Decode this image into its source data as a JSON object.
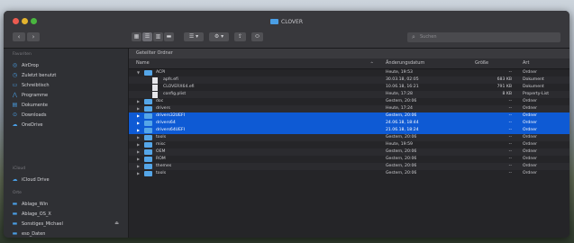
{
  "window": {
    "title": "CLOVER"
  },
  "search": {
    "placeholder": "Suchen"
  },
  "toolbar": {
    "back": "‹",
    "forward": "›",
    "view_icon": "▦",
    "view_list": "☰",
    "view_columns": "▥",
    "view_gallery": "▬",
    "group": "☰ ▾",
    "action": "⚙ ▾",
    "share": "⇪",
    "tag": "⬭"
  },
  "sidebar": {
    "favorites_header": "Favoriten",
    "favorites": [
      {
        "label": "AirDrop",
        "icon": "airdrop-icon",
        "glyph": "◎"
      },
      {
        "label": "Zuletzt benutzt",
        "icon": "clock-icon",
        "glyph": "◷"
      },
      {
        "label": "Schreibtisch",
        "icon": "desktop-icon",
        "glyph": "▭"
      },
      {
        "label": "Programme",
        "icon": "apps-icon",
        "glyph": "⋀"
      },
      {
        "label": "Dokumente",
        "icon": "document-icon",
        "glyph": "▤"
      },
      {
        "label": "Downloads",
        "icon": "download-icon",
        "glyph": "⊙"
      },
      {
        "label": "OneDrive",
        "icon": "cloud-icon",
        "glyph": "☁"
      }
    ],
    "icloud_header": "iCloud",
    "icloud": [
      {
        "label": "iCloud Drive",
        "icon": "cloud-icon",
        "glyph": "☁"
      }
    ],
    "places_header": "Orte",
    "places": [
      {
        "label": "Ablage_Win",
        "icon": "drive-icon",
        "glyph": "▬"
      },
      {
        "label": "Ablage_OS_X",
        "icon": "drive-icon",
        "glyph": "▬"
      },
      {
        "label": "Sonstiges_Michael",
        "icon": "drive-icon",
        "glyph": "▬",
        "eject": "⏏"
      },
      {
        "label": "eso_Daten",
        "icon": "drive-icon",
        "glyph": "▬"
      }
    ]
  },
  "path_bar": "Geteilter Ordner",
  "columns": {
    "name": "Name",
    "date": "Änderungsdatum",
    "size": "Größe",
    "kind": "Art",
    "sort_indicator": "^"
  },
  "rows": [
    {
      "name": "ACPI",
      "date": "Heute, 19:53",
      "size": "--",
      "kind": "Ordner",
      "type": "folder",
      "expanded": true,
      "indent": 0,
      "selected": false
    },
    {
      "name": "apfs.efi",
      "date": "30.03.18, 02:05",
      "size": "683 KB",
      "kind": "Dokument",
      "type": "file",
      "indent": 1,
      "selected": false
    },
    {
      "name": "CLOVERX64.efi",
      "date": "10.06.18, 16:21",
      "size": "791 KB",
      "kind": "Dokument",
      "type": "file",
      "indent": 1,
      "selected": false
    },
    {
      "name": "config.plist",
      "date": "Heute, 17:28",
      "size": "8 KB",
      "kind": "Property-List",
      "type": "file",
      "indent": 1,
      "selected": false
    },
    {
      "name": "doc",
      "date": "Gestern, 20:06",
      "size": "--",
      "kind": "Ordner",
      "type": "folder",
      "indent": 0,
      "selected": false
    },
    {
      "name": "drivers",
      "date": "Heute, 17:24",
      "size": "--",
      "kind": "Ordner",
      "type": "folder",
      "indent": 0,
      "selected": false
    },
    {
      "name": "drivers32UEFI",
      "date": "Gestern, 20:06",
      "size": "--",
      "kind": "Ordner",
      "type": "folder",
      "indent": 0,
      "selected": true
    },
    {
      "name": "drivers64",
      "date": "24.06.18, 18:44",
      "size": "--",
      "kind": "Ordner",
      "type": "folder",
      "indent": 0,
      "selected": true
    },
    {
      "name": "drivers64UEFI",
      "date": "21.06.18, 18:24",
      "size": "--",
      "kind": "Ordner",
      "type": "folder",
      "indent": 0,
      "selected": true
    },
    {
      "name": "tools",
      "date": "Gestern, 20:06",
      "size": "--",
      "kind": "Ordner",
      "type": "folder",
      "indent": 0,
      "selected": false
    },
    {
      "name": "misc",
      "date": "Heute, 19:59",
      "size": "--",
      "kind": "Ordner",
      "type": "folder",
      "indent": 0,
      "selected": false
    },
    {
      "name": "OEM",
      "date": "Gestern, 20:06",
      "size": "--",
      "kind": "Ordner",
      "type": "folder",
      "indent": 0,
      "selected": false
    },
    {
      "name": "ROM",
      "date": "Gestern, 20:06",
      "size": "--",
      "kind": "Ordner",
      "type": "folder",
      "indent": 0,
      "selected": false
    },
    {
      "name": "themes",
      "date": "Gestern, 20:06",
      "size": "--",
      "kind": "Ordner",
      "type": "folder",
      "indent": 0,
      "selected": false
    },
    {
      "name": "tools",
      "date": "Gestern, 20:06",
      "size": "--",
      "kind": "Ordner",
      "type": "folder",
      "indent": 0,
      "selected": false
    }
  ],
  "colors": {
    "selection": "#0e5ad4",
    "folder": "#55a6e8",
    "accent": "#4a9ee4"
  }
}
